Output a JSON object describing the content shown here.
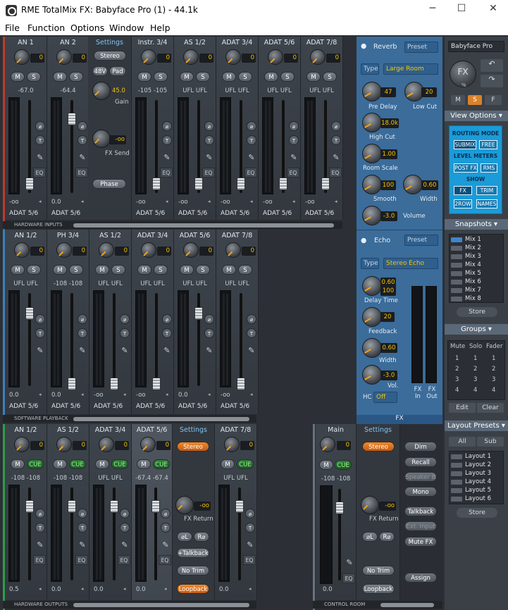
{
  "window": {
    "title": "RME TotalMix FX: Babyface Pro (1) - 44.1k",
    "minimize": "─",
    "maximize": "☐",
    "close": "✕"
  },
  "menu": [
    "File",
    "Function",
    "Options",
    "Window",
    "Help"
  ],
  "inputs": {
    "section_label": "HARDWARE INPUTS",
    "channels": [
      {
        "name": "AN 1",
        "gain": "0",
        "m": "M",
        "s": "S",
        "level": "-67.0",
        "value": "-oo",
        "out": "ADAT 5/6"
      },
      {
        "name": "AN 2",
        "gain": "0",
        "m": "M",
        "s": "S",
        "level": "-64.4",
        "value": "0.0",
        "out": "ADAT 5/6"
      },
      {
        "name": "Instr. 3/4",
        "gain": "0",
        "m": "M",
        "s": "S",
        "level": "-105  -105",
        "value": "-oo",
        "out": "ADAT 5/6"
      },
      {
        "name": "AS 1/2",
        "gain": "0",
        "m": "M",
        "s": "S",
        "level": "UFL  UFL",
        "value": "-oo",
        "out": "ADAT 5/6"
      },
      {
        "name": "ADAT 3/4",
        "gain": "0",
        "m": "M",
        "s": "S",
        "level": "UFL  UFL",
        "value": "-oo",
        "out": "ADAT 5/6"
      },
      {
        "name": "ADAT 5/6",
        "gain": "0",
        "m": "M",
        "s": "S",
        "level": "UFL  UFL",
        "value": "-oo",
        "out": "ADAT 5/6"
      },
      {
        "name": "ADAT 7/8",
        "gain": "0",
        "m": "M",
        "s": "S",
        "level": "UFL  UFL",
        "value": "-oo",
        "out": "ADAT 5/6"
      }
    ],
    "settings": {
      "title": "Settings",
      "stereo": "Stereo",
      "v48": "48V",
      "pad": "Pad",
      "gain_val": "45.0",
      "gain_lbl": "Gain",
      "fxsend_val": "-oo",
      "fxsend_lbl": "FX Send",
      "phase": "Phase"
    }
  },
  "playback": {
    "section_label": "SOFTWARE PLAYBACK",
    "channels": [
      {
        "name": "AN 1/2",
        "level": "UFL  UFL",
        "value": "0.0",
        "out": "ADAT 5/6"
      },
      {
        "name": "PH 3/4",
        "level": "-108  -108",
        "value": "0.0",
        "out": "ADAT 5/6"
      },
      {
        "name": "AS 1/2",
        "level": "UFL  UFL",
        "value": "-oo",
        "out": "ADAT 5/6"
      },
      {
        "name": "ADAT 3/4",
        "level": "UFL  UFL",
        "value": "-oo",
        "out": "ADAT 5/6"
      },
      {
        "name": "ADAT 5/6",
        "level": "UFL  UFL",
        "value": "0.0",
        "out": "ADAT 5/6"
      },
      {
        "name": "ADAT 7/8",
        "level": "UFL  UFL",
        "value": "-oo",
        "out": "ADAT 5/6"
      }
    ],
    "gain": "0",
    "m": "M",
    "s": "S"
  },
  "outputs": {
    "section_label": "HARDWARE OUTPUTS",
    "channels": [
      {
        "name": "AN 1/2",
        "level": "-108  -108",
        "value": "0.5"
      },
      {
        "name": "AS 1/2",
        "level": "-108  -108",
        "value": "0.0"
      },
      {
        "name": "ADAT 3/4",
        "level": "UFL  UFL",
        "value": "0.0"
      },
      {
        "name": "ADAT 5/6",
        "level": "-67.4  -67.4",
        "value": "0.0"
      },
      {
        "name": "ADAT 7/8",
        "level": "UFL  UFL",
        "value": "0.0"
      }
    ],
    "gain": "0",
    "m": "M",
    "cue": "CUE",
    "eq": "EQ",
    "settings": {
      "title": "Settings",
      "stereo": "Stereo",
      "fxret_val": "-oo",
      "fxret_lbl": "FX Return",
      "phl": "⌀L",
      "phr": "R⌀",
      "talkback": "+Talkback",
      "notrim": "No Trim",
      "loopback": "Loopback"
    }
  },
  "control_room": {
    "section_label": "CONTROL ROOM",
    "main": {
      "name": "Main",
      "gain": "0",
      "m": "M",
      "cue": "CUE",
      "level": "-108  -108",
      "value": "0.0"
    },
    "settings": {
      "title": "Settings",
      "stereo": "Stereo",
      "fxret_val": "-oo",
      "fxret_lbl": "FX Return",
      "phl": "⌀L",
      "phr": "R⌀",
      "notrim": "No Trim",
      "loopback": "Loopback"
    },
    "buttons": {
      "dim": "Dim",
      "recall": "Recall",
      "speakerb": "Speaker B",
      "mono": "Mono",
      "talkback": "Talkback",
      "extinput": "Ext. Input",
      "mutefx": "Mute FX",
      "assign": "Assign"
    }
  },
  "fx": {
    "label": "FX",
    "reverb": {
      "title": "Reverb",
      "preset": "Preset",
      "type_lbl": "Type",
      "type": "Large Room",
      "predelay": "47",
      "predelay_lbl": "Pre Delay",
      "lowcut": "20",
      "lowcut_lbl": "Low Cut",
      "highcut": "18.0k",
      "highcut_lbl": "High Cut",
      "roomscale": "1.00",
      "roomscale_lbl": "Room Scale",
      "smooth": "100",
      "smooth_lbl": "Smooth",
      "width": "0.60",
      "width_lbl": "Width",
      "volume": "-3.0",
      "volume_lbl": "Volume"
    },
    "echo": {
      "title": "Echo",
      "preset": "Preset",
      "type_lbl": "Type",
      "type": "Stereo Echo",
      "delay_a": "0.60",
      "delay_b": "100",
      "delay_lbl": "Delay Time",
      "feedback": "20",
      "feedback_lbl": "Feedback",
      "width": "0.60",
      "width_lbl": "Width",
      "vol": "-3.0",
      "vol_lbl": "Vol.",
      "hc_lbl": "HC",
      "hc": "Off",
      "fxin": "FX In",
      "fxout": "FX Out"
    }
  },
  "right": {
    "device": "Babyface Pro",
    "fx_btn": "FX",
    "fx_pct": "%",
    "m": "M",
    "s": "S",
    "f": "F",
    "view_options": "View Options",
    "routing_mode": "ROUTING MODE",
    "submix": "SUBMIX",
    "free": "FREE",
    "level_meters": "LEVEL METERS",
    "postfx": "POST FX",
    "rms": "RMS",
    "show": "SHOW",
    "fx": "FX",
    "trim": "TRIM",
    "row2": "2ROW",
    "names": "NAMES",
    "snapshots": "Snapshots",
    "mixes": [
      "Mix 1",
      "Mix 2",
      "Mix 3",
      "Mix 4",
      "Mix 5",
      "Mix 6",
      "Mix 7",
      "Mix 8"
    ],
    "store": "Store",
    "groups": "Groups",
    "mute": "Mute",
    "solo": "Solo",
    "fader": "Fader",
    "edit": "Edit",
    "clear": "Clear",
    "layout_presets": "Layout Presets",
    "all": "All",
    "sub": "Sub",
    "layouts": [
      "Layout 1",
      "Layout 2",
      "Layout 3",
      "Layout 4",
      "Layout 5",
      "Layout 6"
    ],
    "store2": "Store"
  }
}
